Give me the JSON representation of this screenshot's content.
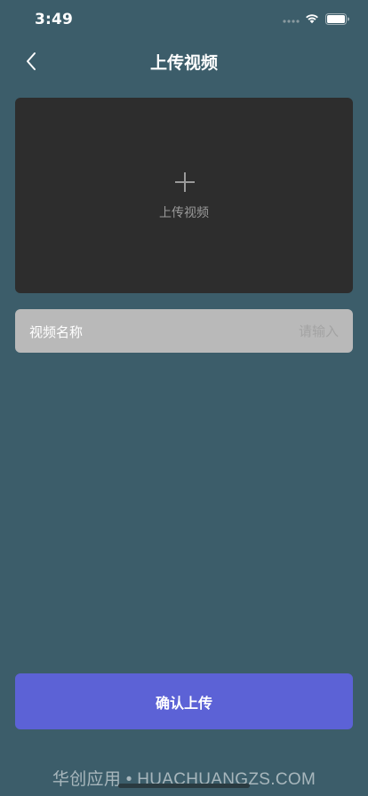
{
  "status_bar": {
    "time": "3:49"
  },
  "nav": {
    "title": "上传视频",
    "back_icon": "chevron-left-icon"
  },
  "upload": {
    "icon": "plus-icon",
    "label": "上传视频"
  },
  "name_field": {
    "label": "视频名称",
    "value": "",
    "placeholder": "请输入"
  },
  "confirm": {
    "label": "确认上传"
  },
  "watermark": {
    "text": "华创应用 • HUACHUANGZS.COM"
  },
  "colors": {
    "background": "#3c5d6a",
    "upload_area": "#2d2d2d",
    "input_bg": "#b9b9b9",
    "accent": "#5c62d6"
  }
}
